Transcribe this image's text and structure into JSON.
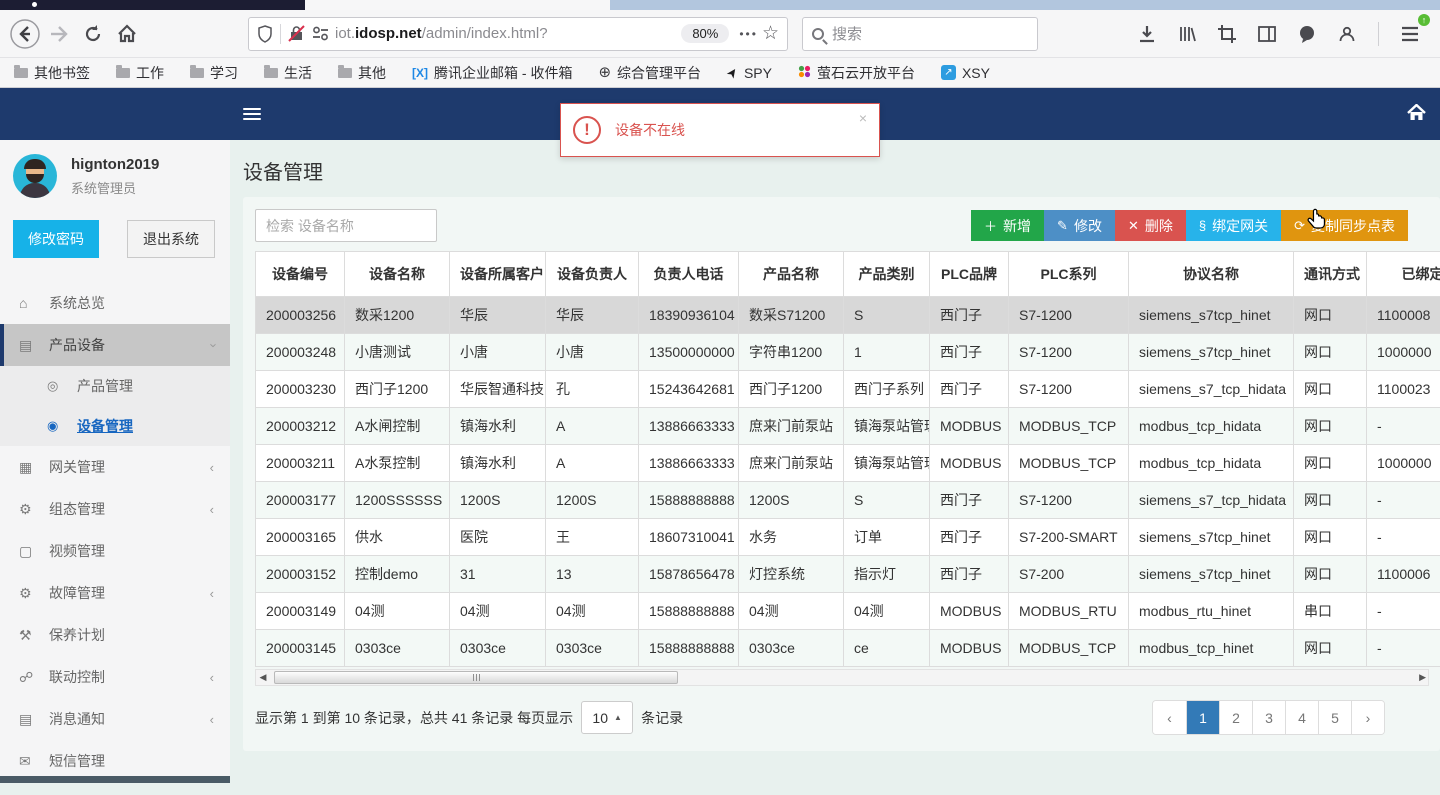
{
  "browser": {
    "url_prefix": "iot.",
    "url_domain": "idosp.net",
    "url_path": "/admin/index.html?",
    "zoom_badge": "80%",
    "search_placeholder": "搜索",
    "bookmarks": [
      {
        "label": "其他书签",
        "icon": "folder-icon"
      },
      {
        "label": "工作",
        "icon": "folder-icon"
      },
      {
        "label": "学习",
        "icon": "folder-icon"
      },
      {
        "label": "生活",
        "icon": "folder-icon"
      },
      {
        "label": "其他",
        "icon": "folder-icon"
      },
      {
        "label": "腾讯企业邮箱 - 收件箱",
        "icon": "tencent-mail-icon"
      },
      {
        "label": "综合管理平台",
        "icon": "globe-icon"
      },
      {
        "label": "SPY",
        "icon": "dart-icon"
      },
      {
        "label": "萤石云开放平台",
        "icon": "color-dots-icon"
      },
      {
        "label": "XSY",
        "icon": "arrow-square-icon"
      }
    ]
  },
  "alert": {
    "text": "设备不在线",
    "close": "×"
  },
  "sidebar": {
    "user": {
      "name": "hignton2019",
      "role": "系统管理员"
    },
    "change_password": "修改密码",
    "logout": "退出系统",
    "menu": [
      {
        "label": "系统总览",
        "icon": "home-icon",
        "chevron": ""
      },
      {
        "label": "产品设备",
        "icon": "product-icon",
        "chevron": "down",
        "active": true,
        "children": [
          {
            "label": "产品管理",
            "active": false
          },
          {
            "label": "设备管理",
            "active": true
          }
        ]
      },
      {
        "label": "网关管理",
        "icon": "gateway-icon",
        "chevron": "left"
      },
      {
        "label": "组态管理",
        "icon": "config-gear-icon",
        "chevron": "left"
      },
      {
        "label": "视频管理",
        "icon": "video-icon",
        "chevron": ""
      },
      {
        "label": "故障管理",
        "icon": "fault-gear-icon",
        "chevron": "left"
      },
      {
        "label": "保养计划",
        "icon": "wrench-icon",
        "chevron": ""
      },
      {
        "label": "联动控制",
        "icon": "linkage-icon",
        "chevron": "left"
      },
      {
        "label": "消息通知",
        "icon": "message-icon",
        "chevron": "left"
      },
      {
        "label": "短信管理",
        "icon": "sms-icon",
        "chevron": ""
      }
    ]
  },
  "page": {
    "title": "设备管理",
    "search_placeholder": "检索 设备名称",
    "actions": [
      {
        "label": "新增",
        "icon": "plus-icon",
        "color": "#22a649"
      },
      {
        "label": "修改",
        "icon": "pencil-icon",
        "color": "#4d8fc6"
      },
      {
        "label": "删除",
        "icon": "x-icon",
        "color": "#d9534f"
      },
      {
        "label": "绑定网关",
        "icon": "link-icon",
        "color": "#27b3ea"
      },
      {
        "label": "复制同步点表",
        "icon": "sync-icon",
        "color": "#e0950f"
      }
    ],
    "table": {
      "columns": [
        "设备编号",
        "设备名称",
        "设备所属客户",
        "设备负责人",
        "负责人电话",
        "产品名称",
        "产品类别",
        "PLC品牌",
        "PLC系列",
        "协议名称",
        "通讯方式",
        "已绑定网关"
      ],
      "rows": [
        [
          "200003256",
          "数采1200",
          "华辰",
          "华辰",
          "18390936104",
          "数采S71200",
          "S",
          "西门子",
          "S7-1200",
          "siemens_s7tcp_hinet",
          "网口",
          "1100008"
        ],
        [
          "200003248",
          "小唐测试",
          "小唐",
          "小唐",
          "13500000000",
          "字符串1200",
          "1",
          "西门子",
          "S7-1200",
          "siemens_s7tcp_hinet",
          "网口",
          "1000000"
        ],
        [
          "200003230",
          "西门子1200",
          "华辰智通科技",
          "孔",
          "15243642681",
          "西门子1200",
          "西门子系列",
          "西门子",
          "S7-1200",
          "siemens_s7_tcp_hidata",
          "网口",
          "1100023"
        ],
        [
          "200003212",
          "A水闸控制",
          "镇海水利",
          "A",
          "13886663333",
          "庶来门前泵站",
          "镇海泵站管理",
          "MODBUS",
          "MODBUS_TCP",
          "modbus_tcp_hidata",
          "网口",
          "-"
        ],
        [
          "200003211",
          "A水泵控制",
          "镇海水利",
          "A",
          "13886663333",
          "庶来门前泵站",
          "镇海泵站管理",
          "MODBUS",
          "MODBUS_TCP",
          "modbus_tcp_hidata",
          "网口",
          "1000000"
        ],
        [
          "200003177",
          "1200SSSSSS",
          "1200S",
          "1200S",
          "15888888888",
          "1200S",
          "S",
          "西门子",
          "S7-1200",
          "siemens_s7_tcp_hidata",
          "网口",
          "-"
        ],
        [
          "200003165",
          "供水",
          "医院",
          "王",
          "18607310041",
          "水务",
          "订单",
          "西门子",
          "S7-200-SMART",
          "siemens_s7tcp_hinet",
          "网口",
          "-"
        ],
        [
          "200003152",
          "控制demo",
          "31",
          "13",
          "15878656478",
          "灯控系统",
          "指示灯",
          "西门子",
          "S7-200",
          "siemens_s7tcp_hinet",
          "网口",
          "1100006"
        ],
        [
          "200003149",
          "04测",
          "04测",
          "04测",
          "15888888888",
          "04测",
          "04测",
          "MODBUS",
          "MODBUS_RTU",
          "modbus_rtu_hinet",
          "串口",
          "-"
        ],
        [
          "200003145",
          "0303ce",
          "0303ce",
          "0303ce",
          "15888888888",
          "0303ce",
          "ce",
          "MODBUS",
          "MODBUS_TCP",
          "modbus_tcp_hinet",
          "网口",
          "-"
        ]
      ],
      "selected_row": 0
    },
    "pagination": {
      "summary_before": "显示第 1 到第 10 条记录，总共 41 条记录 每页显示",
      "page_size": "10",
      "summary_after": "条记录",
      "prev": "‹",
      "pages": [
        "1",
        "2",
        "3",
        "4",
        "5"
      ],
      "active_page": "1",
      "next": "›"
    }
  }
}
